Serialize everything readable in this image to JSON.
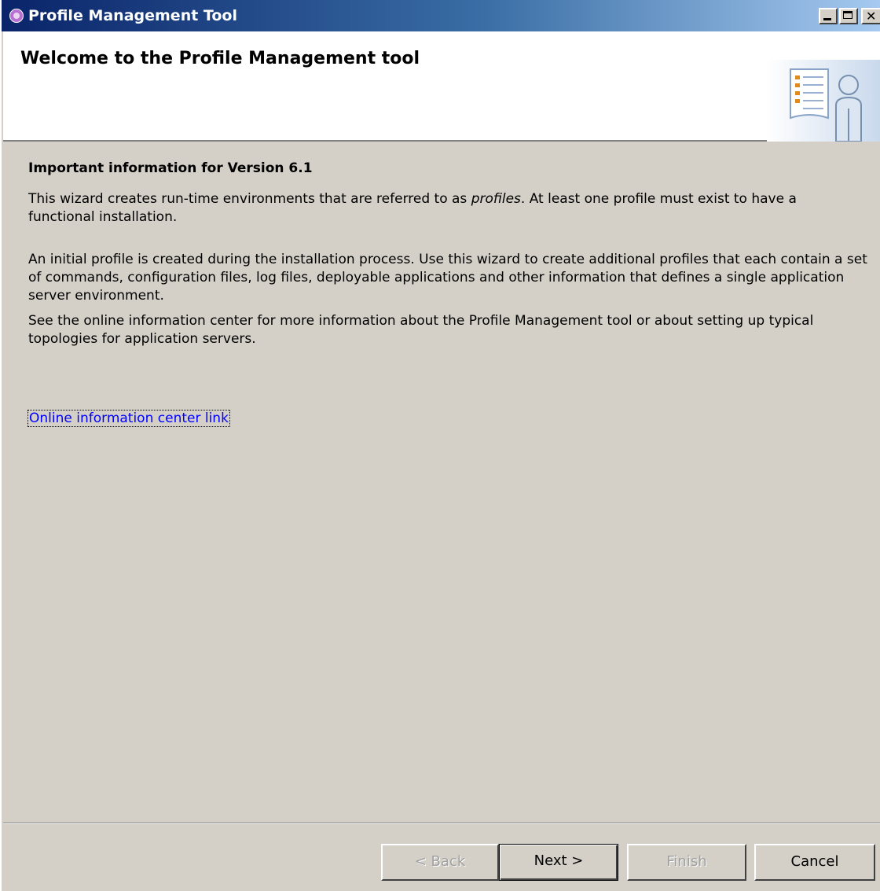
{
  "window": {
    "title": "Profile Management Tool"
  },
  "header": {
    "title": "Welcome to the Profile Management tool",
    "graphic_icon": "checklist-person-icon"
  },
  "content": {
    "heading": "Important information for Version 6.1",
    "p1_before": "This wizard creates run-time environments that are referred to as ",
    "p1_emphasis": "profiles",
    "p1_after": ". At least one profile must exist to have a functional installation.",
    "p2": "An initial profile is created during the installation process. Use this wizard to create additional profiles that each contain a set of commands, configuration files, log files, deployable applications and other information that defines a single application server environment.",
    "p3": "See the online information center for more information about the Profile Management tool or about setting up typical topologies for application servers.",
    "link": "Online information center link"
  },
  "buttons": {
    "back": "< Back",
    "next": "Next >",
    "finish": "Finish",
    "cancel": "Cancel"
  },
  "colors": {
    "titlebar_start": "#0a246a",
    "window_bg": "#d4d0c8",
    "link": "#0000ff"
  }
}
